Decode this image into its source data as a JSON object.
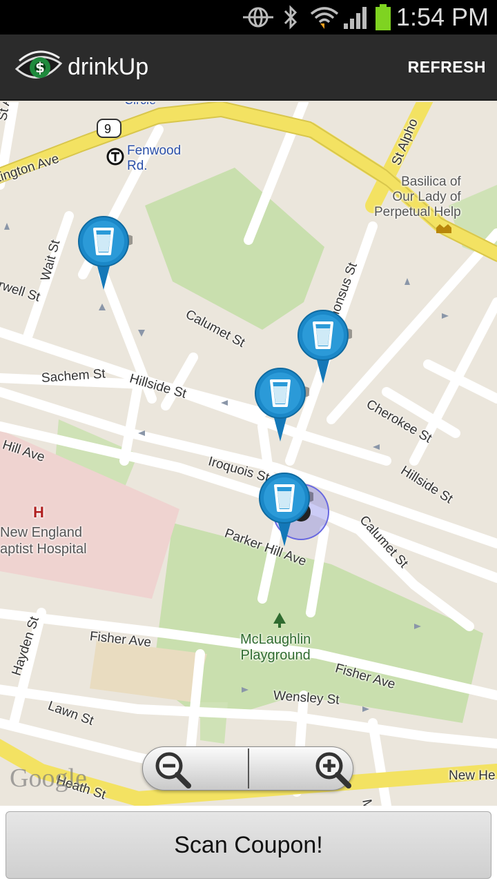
{
  "status_bar": {
    "time": "1:54 PM",
    "icons": [
      "location-icon",
      "bluetooth-icon",
      "wifi-icon",
      "signal-icon",
      "battery-icon"
    ],
    "battery_color": "#7fd321"
  },
  "action_bar": {
    "title": "drinkUp",
    "refresh_label": "REFRESH",
    "logo_icon": "eye-dollar-logo-icon"
  },
  "map": {
    "route_shield": "9",
    "places": {
      "fenwood": "Fenwood\nRd.",
      "circle": "Circle",
      "basilica": "Basilica of\nOur Lady of\nPerpetual Help",
      "hospital": "New England\naptist Hospital",
      "playground": "McLaughlin\nPlayground",
      "hospital_marker": "H"
    },
    "streets": {
      "st_alb": "St Alb",
      "huntington": "tington Ave",
      "st_alphonsus_top": "St Alpho",
      "wait": "Wait St",
      "rwell": "rwell St",
      "calumet_upper": "Calumet St",
      "alphonsus": "phonsus St",
      "sachem": "Sachem St",
      "hillside_left": "Hillside St",
      "cherokee": "Cherokee St",
      "hill_ave": "Hill Ave",
      "iroquois": "Iroquois St",
      "hillside_right": "Hillside St",
      "calumet_lower": "Calumet St",
      "parker_hill": "Parker Hill Ave",
      "hayden": "Hayden St",
      "fisher_left": "Fisher Ave",
      "fisher_right": "Fisher Ave",
      "wensley": "Wensley St",
      "lawn": "Lawn St",
      "heath": "Heath St",
      "new_he": "New He",
      "mel": "Mel"
    },
    "markers": [
      "bar-marker-1",
      "bar-marker-2",
      "bar-marker-3",
      "bar-marker-4"
    ],
    "google_logo": "Google",
    "zoom_out_icon": "zoom-out-icon",
    "zoom_in_icon": "zoom-in-icon"
  },
  "bottom": {
    "scan_label": "Scan Coupon!"
  }
}
